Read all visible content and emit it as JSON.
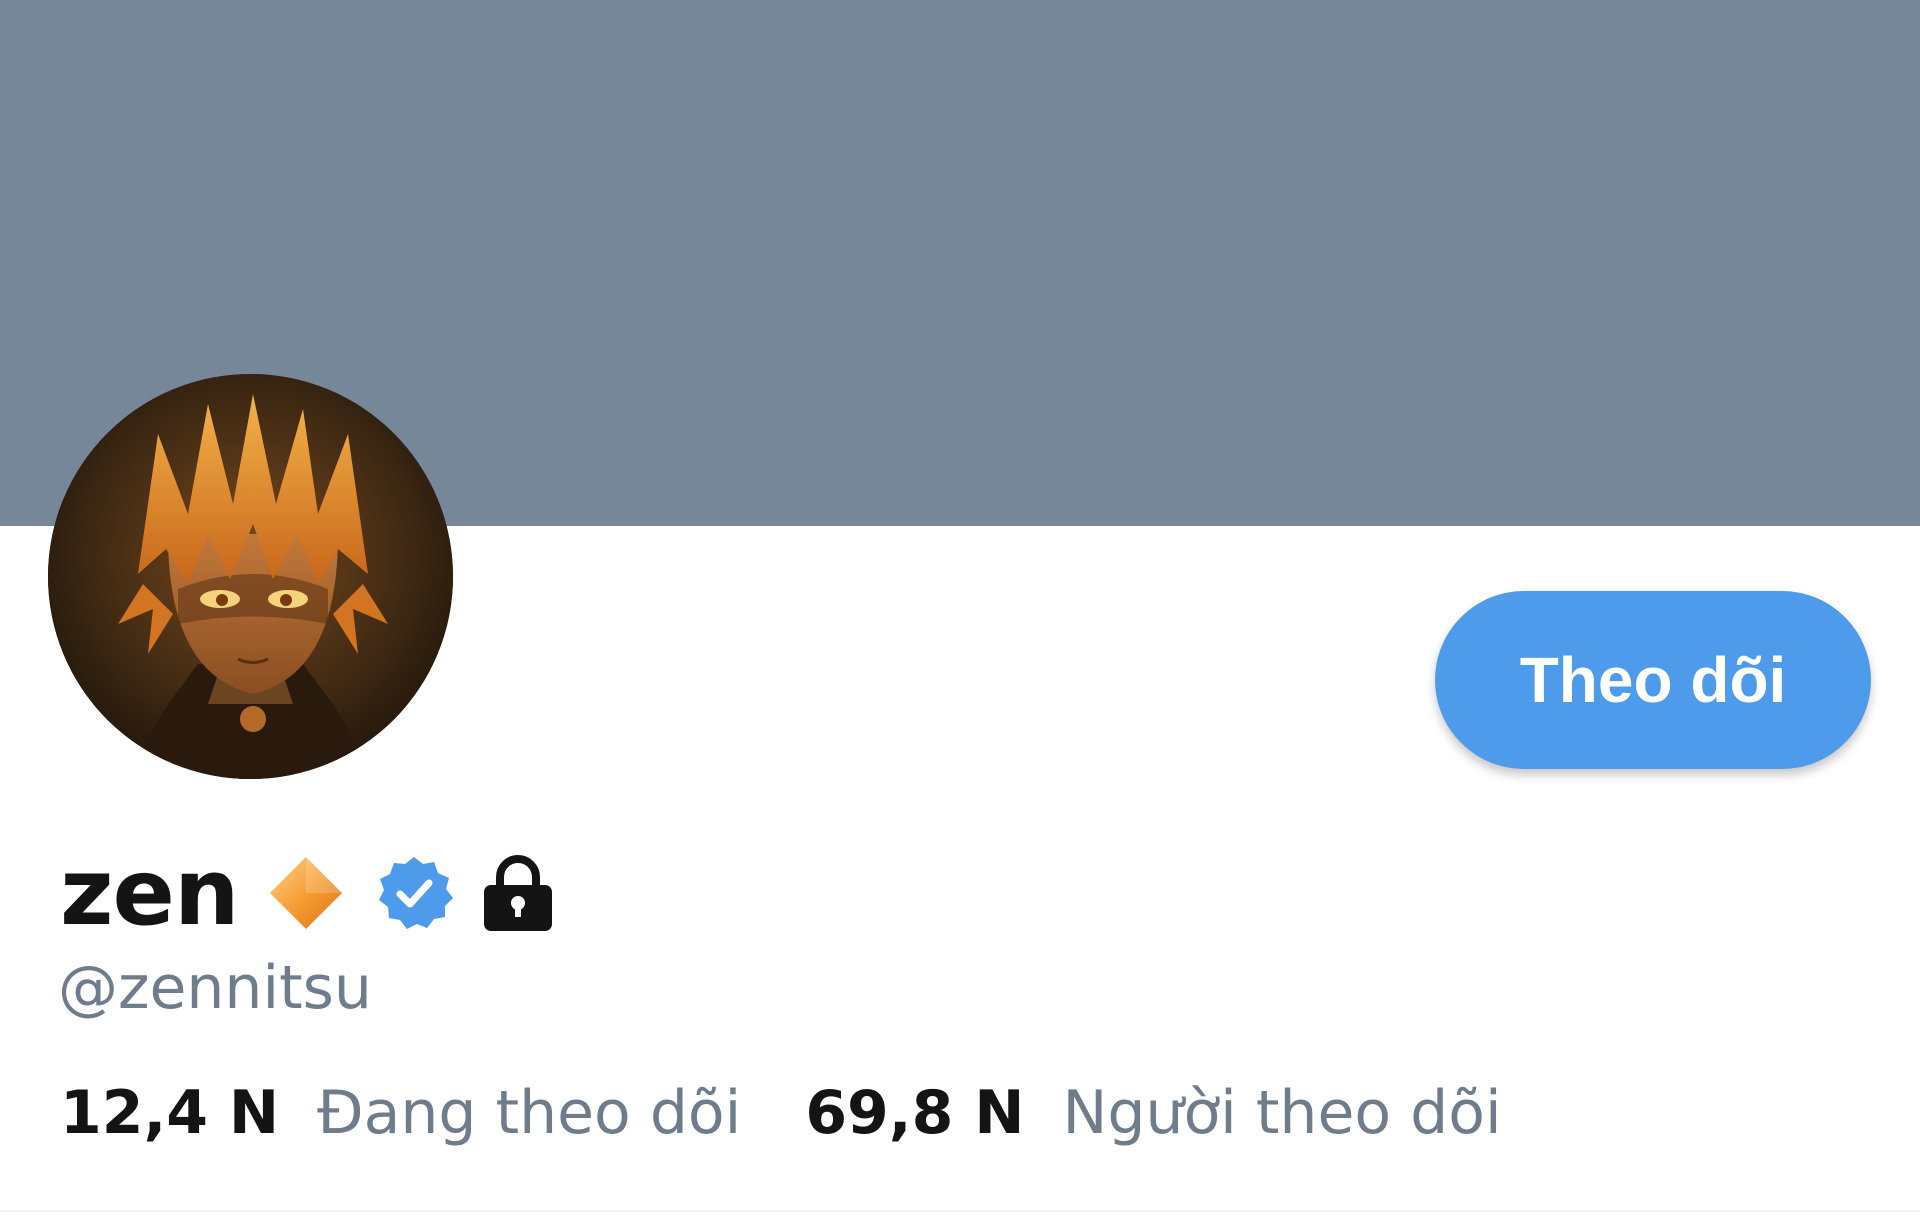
{
  "profile": {
    "display_name": "zen",
    "handle": "@zennitsu",
    "follow_button_label": "Theo dõi",
    "stats": {
      "following_count": "12,4 N",
      "following_label": "Đang theo dõi",
      "followers_count": "69,8 N",
      "followers_label": "Người theo dõi"
    },
    "badges": [
      "orange-diamond-icon",
      "verified-badge-icon",
      "lock-icon"
    ]
  },
  "colors": {
    "banner": "#76879a",
    "accent": "#4d9bea",
    "text_primary": "#141414",
    "text_secondary": "#6e7c8c"
  }
}
